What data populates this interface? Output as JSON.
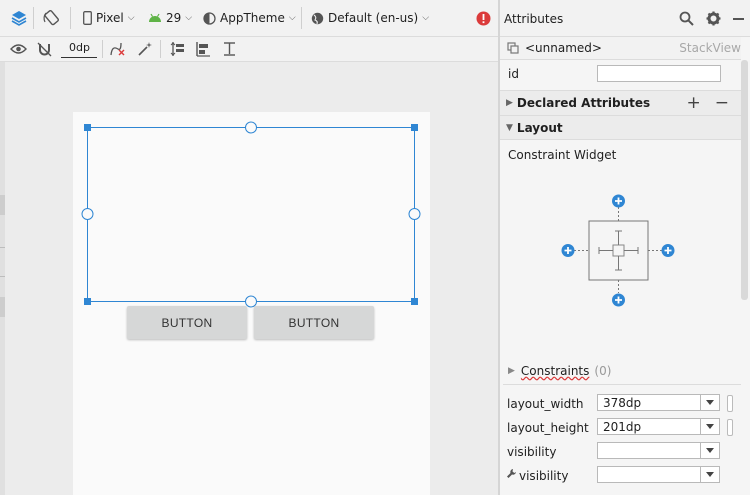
{
  "toolbar": {
    "device": "Pixel",
    "api_level": "29",
    "theme": "AppTheme",
    "locale": "Default (en-us)",
    "margin": "0dp"
  },
  "canvas": {
    "buttons": [
      "BUTTON",
      "BUTTON"
    ]
  },
  "attributes": {
    "title": "Attributes",
    "component_name": "<unnamed>",
    "component_type": "StackView",
    "id_label": "id",
    "id_value": "",
    "declared_title": "Declared Attributes",
    "layout_title": "Layout",
    "constraint_widget": "Constraint Widget",
    "constraints_label": "Constraints",
    "constraints_count": "(0)",
    "layout_width_label": "layout_width",
    "layout_width_value": "378dp",
    "layout_height_label": "layout_height",
    "layout_height_value": "201dp",
    "visibility_label": "visibility",
    "visibility_value": "",
    "tools_visibility_label": "visibility",
    "tools_visibility_value": ""
  },
  "colors": {
    "accent": "#2f86d3",
    "error": "#db3b3b",
    "android_green": "#5fb347"
  }
}
